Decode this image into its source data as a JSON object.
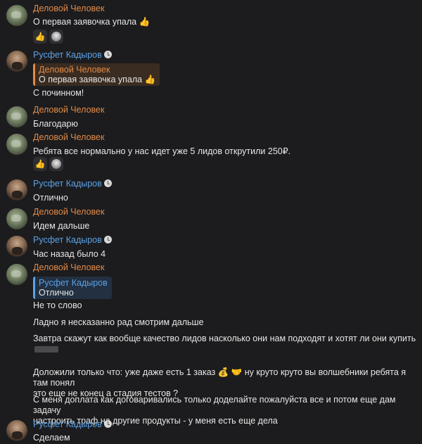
{
  "authors": {
    "dc": "Деловой Человек",
    "rk": "Русфет Кадыров"
  },
  "messages": [
    {
      "text": "О первая заявочка упала 👍",
      "reactions": [
        "👍"
      ]
    },
    {
      "reply_name": "Деловой Человек",
      "reply_text": "О первая заявочка упала 👍",
      "text": "С починном!"
    },
    {
      "text": "Благодарю"
    },
    {
      "text": "Ребята все нормально у нас идет уже 5 лидов открутили 250₽.",
      "reactions": [
        "👍"
      ]
    },
    {
      "text": "Отлично"
    },
    {
      "text": "Идем дальше"
    },
    {
      "text": "Час назад было 4"
    },
    {
      "reply_name": "Русфет Кадыров",
      "reply_text": "Отлично",
      "text": "Не то слово"
    },
    {
      "text": "Ладно я несказанно рад смотрим дальше"
    },
    {
      "text": "Завтра скажут как вообще качество лидов насколько они нам подходят и хотят ли они купить"
    },
    {
      "text": "Доложили только что: уже даже есть 1 заказ 💰 🤝 ну круто круто вы волшебники ребята я там понял\nэто еще не конец а стадия тестов ?"
    },
    {
      "text": "С меня доплата как договаривались только доделайте пожалуйста все и потом еще дам задачу\nнастроить траф на другие продукты - у меня есть еще дела"
    },
    {
      "text": "Сделаем"
    }
  ]
}
